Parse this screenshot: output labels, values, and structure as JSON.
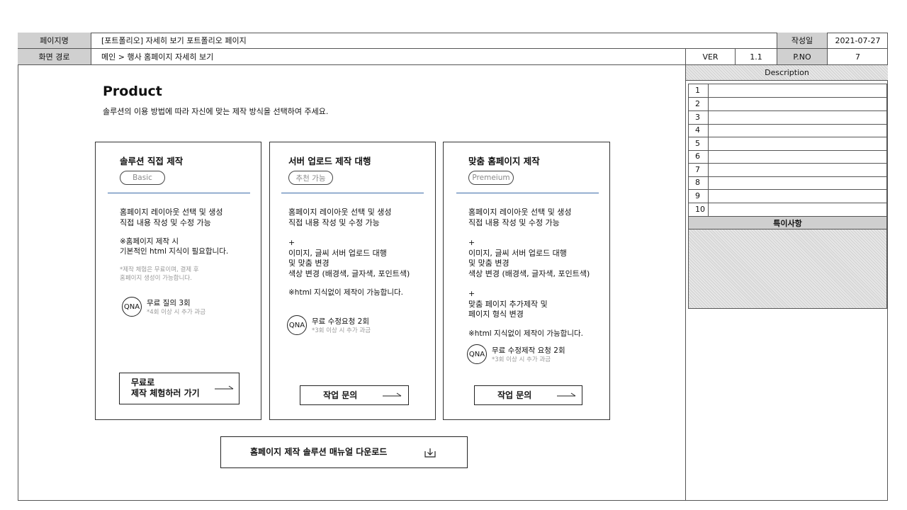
{
  "header": {
    "page_name_label": "페이지명",
    "page_name": "[포트폴리오] 자세히 보기 포트폴리오 페이지",
    "created_label": "작성일",
    "created_date": "2021-07-27",
    "path_label": "화면 경로",
    "path": "메인 > 행사 홈페이지 자세히 보기",
    "ver_label": "VER",
    "ver": "1.1",
    "pno_label": "P.NO",
    "pno": "7"
  },
  "sidebar": {
    "description_title": "Description",
    "rows": [
      "1",
      "2",
      "3",
      "4",
      "5",
      "6",
      "7",
      "8",
      "9",
      "10"
    ],
    "notes_title": "특이사항"
  },
  "main": {
    "title": "Product",
    "subtitle": "솔루션의 이용 방법에 따라 자신에 맞는 제작 방식을 선택하여 주세요.",
    "cards": [
      {
        "title": "솔루션 직접 제작",
        "badge": "Basic",
        "line1": "홈페이지 레이아웃 선택 및 생성",
        "line2": "직접 내용 작성 및 수정 가능",
        "note1": "※홈페이지 제작 시",
        "note2": "기본적인 html 지식이 필요합니다.",
        "small1": "*제작 체험은 무료이며, 결제 후",
        "small2": "홈페이지 생성이 가능합니다.",
        "qna_icon": "QNA",
        "qna_text": "무료 질의 3회",
        "qna_sub": "*4회 이상 시 추가 과금",
        "button_line1": "무료로",
        "button_line2": "제작 체험하러 가기"
      },
      {
        "title": "서버 업로드 제작 대행",
        "badge": "추천 가능",
        "line1": "홈페이지 레이아웃 선택 및 생성",
        "line2": "직접 내용 작성 및 수정 가능",
        "plus": "+",
        "add1": "이미지, 글씨 서버 업로드 대행",
        "add2": "및 맞춤 변경",
        "add3": "색상 변경 (배경색, 글자색, 포인트색)",
        "note": "※html 지식없이 제작이 가능합니다.",
        "qna_icon": "QNA",
        "qna_text": "무료 수정요청 2회",
        "qna_sub": "*3회 이상 시 추가 과금",
        "button": "작업 문의"
      },
      {
        "title": "맞춤 홈페이지 제작",
        "badge": "Premeium",
        "line1": "홈페이지 레이아웃 선택 및 생성",
        "line2": "직접 내용 작성 및 수정 가능",
        "plus1": "+",
        "add1": "이미지, 글씨 서버 업로드 대행",
        "add2": "및 맞춤 변경",
        "add3": "색상 변경 (배경색, 글자색, 포인트색)",
        "plus2": "+",
        "add4": "맞춤 페이지 추가제작 및",
        "add5": "페이지 형식 변경",
        "note": "※html 지식없이 제작이 가능합니다.",
        "qna_icon": "QNA",
        "qna_text": "무료 수정제작 요청 2회",
        "qna_sub": "*3회 이상 시 추가 과금",
        "button": "작업 문의"
      }
    ],
    "download_button": "홈페이지 제작 솔루션 매뉴얼 다운로드"
  }
}
